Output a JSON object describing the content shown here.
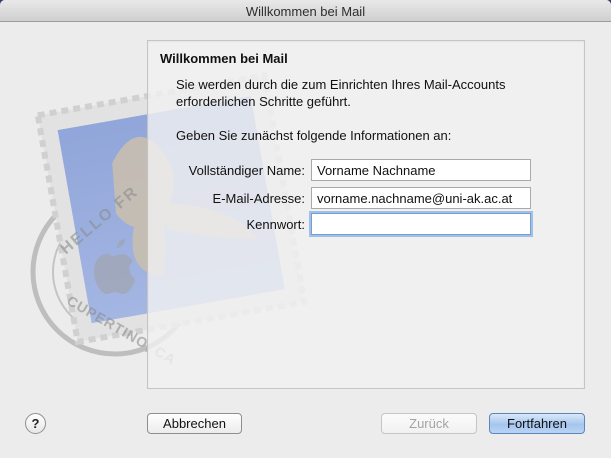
{
  "window": {
    "title": "Willkommen bei Mail"
  },
  "content": {
    "heading": "Willkommen bei Mail",
    "intro_line1": "Sie werden durch die zum Einrichten Ihres Mail-Accounts",
    "intro_line2": "erforderlichen Schritte geführt.",
    "instruction": "Geben Sie zunächst folgende Informationen an:"
  },
  "form": {
    "full_name_label": "Vollständiger Name:",
    "full_name_value": "Vorname Nachname",
    "email_label": "E-Mail-Adresse:",
    "email_value": "vorname.nachname@uni-ak.ac.at",
    "password_label": "Kennwort:",
    "password_value": ""
  },
  "stamp": {
    "text_top": "HELLO FR",
    "text_bottom": "CUPERTINO, CA"
  },
  "buttons": {
    "help": "?",
    "cancel": "Abbrechen",
    "back": "Zurück",
    "continue": "Fortfahren"
  },
  "colors": {
    "accent": "#a6c6ee",
    "focus_ring": "#6fa1d7"
  }
}
